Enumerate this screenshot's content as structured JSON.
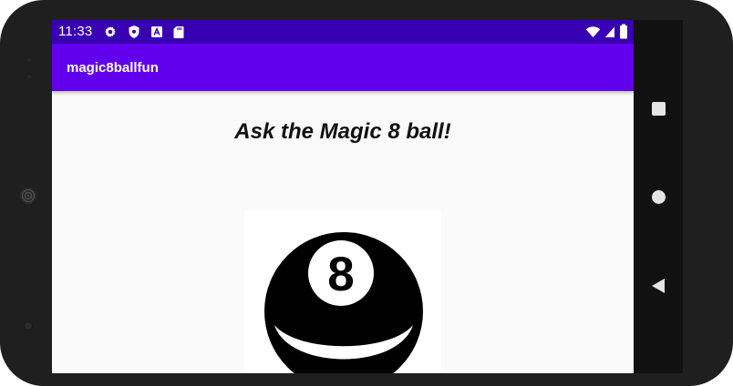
{
  "status_bar": {
    "time": "11:33",
    "left_icons": [
      "gear-icon",
      "shield-icon",
      "font-badge-icon",
      "sd-card-icon"
    ],
    "right_icons": [
      "wifi-icon",
      "signal-icon",
      "battery-icon"
    ],
    "background": "#3700b3"
  },
  "app_bar": {
    "title": "magic8ballfun",
    "background": "#6200ee"
  },
  "main": {
    "heading": "Ask the Magic 8 ball!",
    "ball": {
      "number": "8",
      "icon": "magic-8-ball-icon"
    }
  },
  "navigation": {
    "buttons": [
      "recents-button",
      "home-button",
      "back-button"
    ]
  }
}
